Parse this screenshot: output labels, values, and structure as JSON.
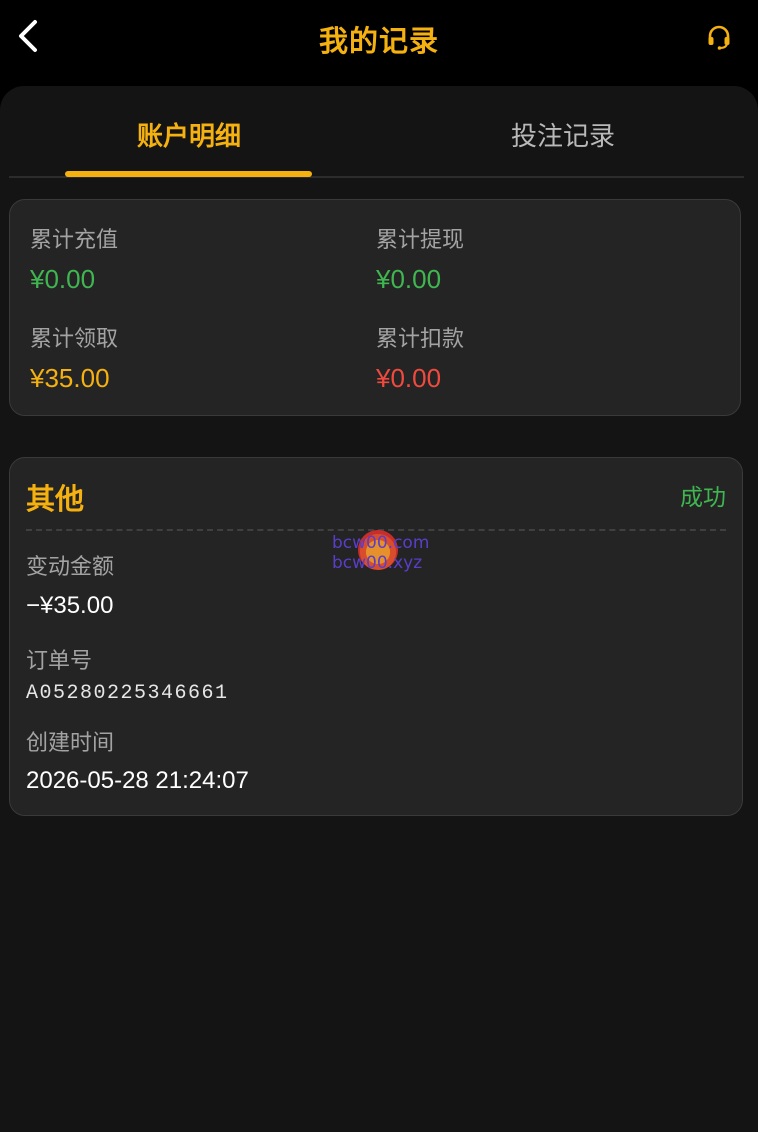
{
  "header": {
    "title": "我的记录",
    "back_icon": "chevron-left-icon",
    "support_icon": "headset-icon"
  },
  "tabs": [
    {
      "label": "账户明细",
      "active": true
    },
    {
      "label": "投注记录",
      "active": false
    }
  ],
  "summary": {
    "items": [
      {
        "label": "累计充值",
        "value": "¥0.00",
        "color": "#3fb650"
      },
      {
        "label": "累计提现",
        "value": "¥0.00",
        "color": "#3fb650"
      },
      {
        "label": "累计领取",
        "value": "¥35.00",
        "color": "#f5b10f"
      },
      {
        "label": "累计扣款",
        "value": "¥0.00",
        "color": "#f04a3e"
      }
    ]
  },
  "record": {
    "type": "其他",
    "status": "成功",
    "amount_label": "变动金额",
    "amount": "−¥35.00",
    "order_label": "订单号",
    "order_no": "A05280225346661",
    "created_label": "创建时间",
    "created_at": "2026-05-28 21:24:07"
  },
  "watermark": {
    "line1": "bcw00.com",
    "line2": "bcw00.xyz"
  },
  "colors": {
    "accent": "#f5b10f",
    "success": "#3fb650",
    "danger": "#f04a3e",
    "background": "#000000",
    "card": "#242424"
  }
}
